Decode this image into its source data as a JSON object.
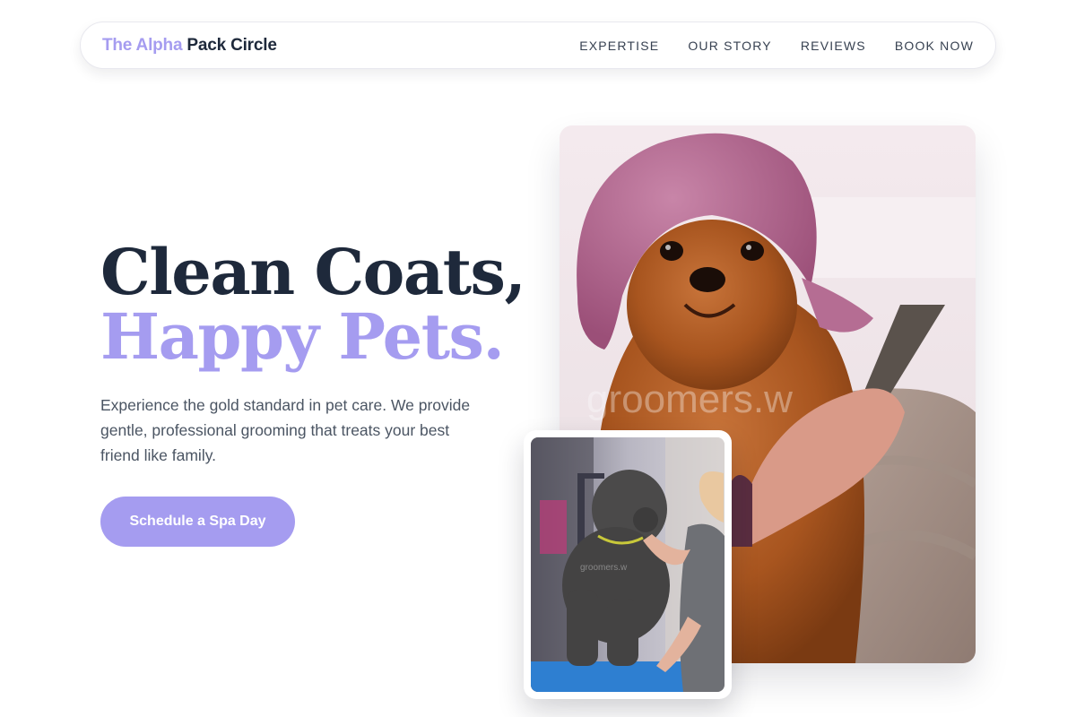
{
  "nav": {
    "brand_light": "The Alpha ",
    "brand_dark": "Pack Circle",
    "links": [
      "EXPERTISE",
      "OUR STORY",
      "REVIEWS",
      "BOOK NOW"
    ]
  },
  "hero": {
    "headline_line1": "Clean Coats,",
    "headline_line2": "Happy Pets.",
    "subtext": "Experience the gold standard in pet care. We provide gentle, professional grooming that treats your best friend like family.",
    "cta_label": "Schedule a Spa Day"
  },
  "images": {
    "main_watermark": "groomers.w",
    "small_watermark": "groomers.w"
  },
  "colors": {
    "accent": "#a59cf0",
    "heading_dark": "#1e293b",
    "body_text": "#4b5563"
  }
}
